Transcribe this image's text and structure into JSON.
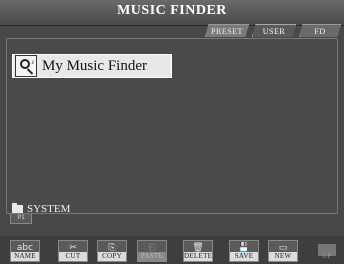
{
  "window": {
    "title": "MUSIC FINDER"
  },
  "tabs": [
    {
      "label": "PRESET"
    },
    {
      "label": "USER"
    },
    {
      "label": "FD"
    }
  ],
  "active_tab": "USER",
  "files": [
    {
      "name": "My Music Finder",
      "icon": "music-finder-file-icon",
      "selected": true
    }
  ],
  "folder": {
    "label": "SYSTEM",
    "icon": "folder-icon"
  },
  "page_tab": {
    "label": "P1"
  },
  "buttons": {
    "name": {
      "glyph": "abc",
      "label": "NAME"
    },
    "cut": {
      "glyph": "✂",
      "label": "CUT"
    },
    "copy": {
      "glyph": "⎘",
      "label": "COPY"
    },
    "paste": {
      "glyph": "⎗",
      "label": "PASTE"
    },
    "delete": {
      "glyph": "🗑",
      "label": "DELETE"
    },
    "save": {
      "glyph": "💾",
      "label": "SAVE"
    },
    "new": {
      "glyph": "▭",
      "label": "NEW"
    },
    "up": {
      "label": "UP"
    }
  }
}
